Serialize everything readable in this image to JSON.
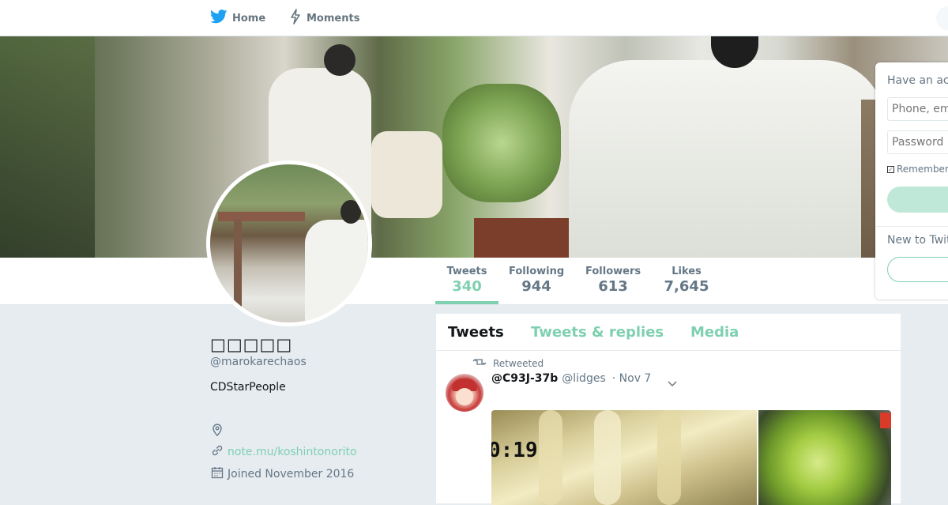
{
  "nav": {
    "home_label": "Home",
    "moments_label": "Moments"
  },
  "stats": [
    {
      "label": "Tweets",
      "value": "340"
    },
    {
      "label": "Following",
      "value": "944"
    },
    {
      "label": "Followers",
      "value": "613"
    },
    {
      "label": "Likes",
      "value": "7,645"
    }
  ],
  "profile": {
    "name": "□□□□□",
    "handle": "@marokarechaos",
    "bio": "CDStarPeople",
    "url": "note.mu/koshintonorito",
    "joined": "Joined November 2016"
  },
  "timeline": {
    "tabs": [
      "Tweets",
      "Tweets & replies",
      "Media"
    ],
    "tweet": {
      "retweeted_label": "Retweeted",
      "name": "@C93J-37b",
      "handle": "@lidges",
      "date": "· Nov 7",
      "media_time": "0:19"
    }
  },
  "login": {
    "heading": "Have an account?",
    "phone_placeholder": "Phone, email or username",
    "password_placeholder": "Password",
    "remember_label": "Remember me",
    "new_label": "New to Twitter?"
  },
  "colors": {
    "accent": "#7fd0b0",
    "twitter_blue": "#1da1f2",
    "background": "#e6ecf0"
  }
}
